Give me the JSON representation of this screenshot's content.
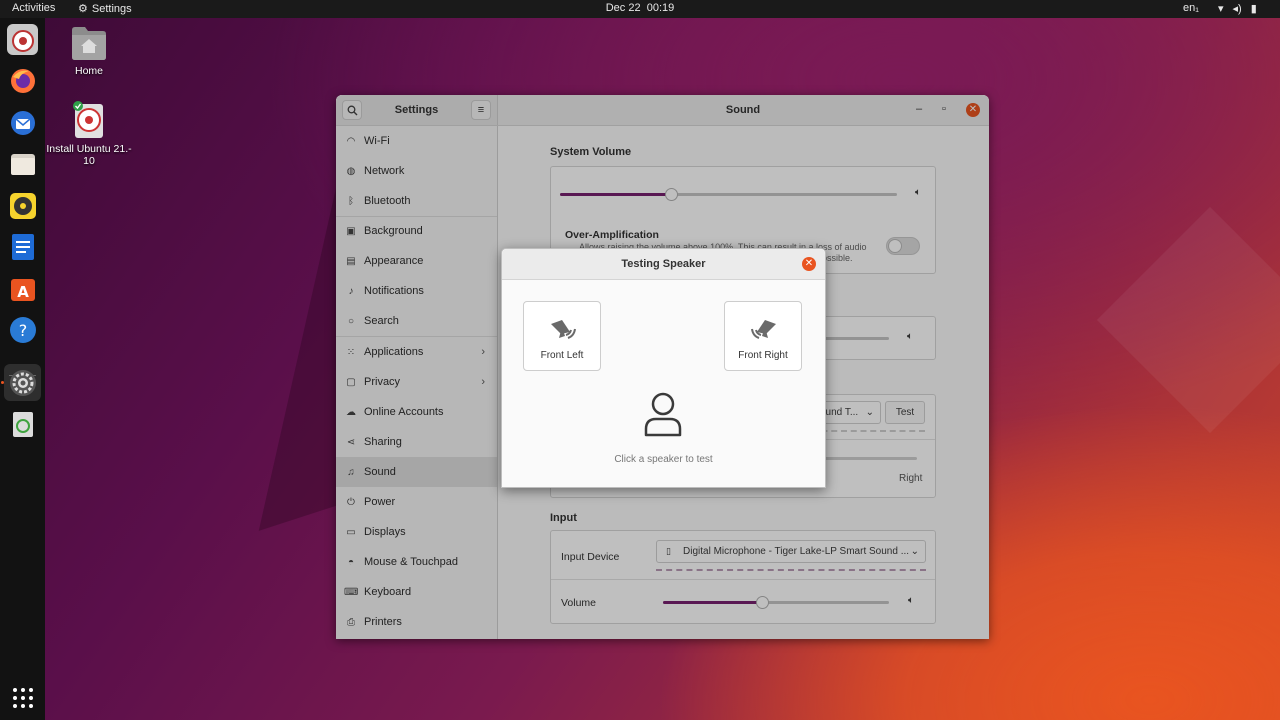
{
  "topbar": {
    "activities": "Activities",
    "app_name": "Settings",
    "date": "Dec 22",
    "time": "00:19",
    "lang": "en₁"
  },
  "desktop": {
    "home_label": "Home",
    "install_label_line1": "Install Ubuntu 21.-",
    "install_label_line2": "10"
  },
  "window": {
    "sidebar_title": "Settings",
    "main_title": "Sound",
    "sidebar_items": [
      {
        "label": "Wi-Fi",
        "icon": "wifi-icon"
      },
      {
        "label": "Network",
        "icon": "network-icon"
      },
      {
        "label": "Bluetooth",
        "icon": "bluetooth-icon"
      },
      {
        "label": "Background",
        "icon": "background-icon"
      },
      {
        "label": "Appearance",
        "icon": "appearance-icon"
      },
      {
        "label": "Notifications",
        "icon": "bell-icon"
      },
      {
        "label": "Search",
        "icon": "search-icon"
      },
      {
        "label": "Applications",
        "icon": "apps-icon"
      },
      {
        "label": "Privacy",
        "icon": "privacy-icon"
      },
      {
        "label": "Online Accounts",
        "icon": "cloud-icon"
      },
      {
        "label": "Sharing",
        "icon": "share-icon"
      },
      {
        "label": "Sound",
        "icon": "music-note-icon"
      },
      {
        "label": "Power",
        "icon": "power-icon"
      },
      {
        "label": "Displays",
        "icon": "display-icon"
      },
      {
        "label": "Mouse & Touchpad",
        "icon": "mouse-icon"
      },
      {
        "label": "Keyboard",
        "icon": "keyboard-icon"
      },
      {
        "label": "Printers",
        "icon": "printer-icon"
      }
    ],
    "sound": {
      "system_volume_title": "System Volume",
      "system_volume_level": 0.33,
      "over_amp_title": "Over-Amplification",
      "over_amp_desc_1": "Allows raising the volume above 100%. This can result in a loss of audio",
      "over_amp_desc_2": "possible.",
      "output_device_partial": "ound T...",
      "test_label": "Test",
      "balance_right": "Right",
      "input_title": "Input",
      "input_device_label": "Input Device",
      "input_device_value": "Digital Microphone - Tiger Lake-LP Smart Sound ...",
      "input_volume_label": "Volume",
      "input_volume_level": 0.44
    }
  },
  "dialog": {
    "title": "Testing Speaker",
    "front_left": "Front Left",
    "front_right": "Front Right",
    "hint": "Click a speaker to test"
  },
  "colors": {
    "accent": "#77216f",
    "orange": "#e95420"
  }
}
